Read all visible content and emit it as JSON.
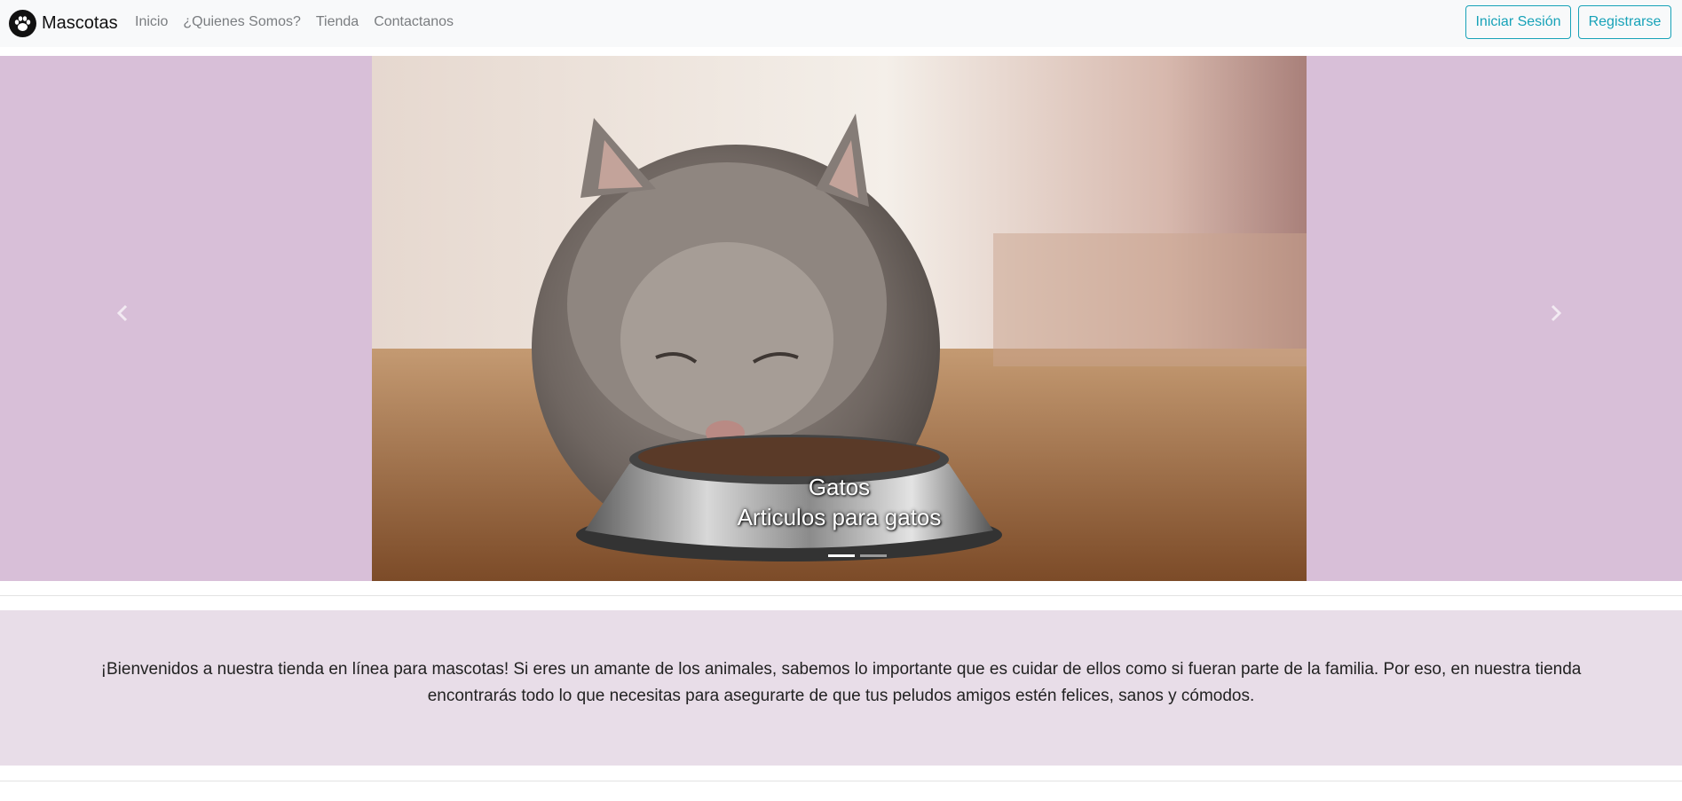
{
  "navbar": {
    "brand": "Mascotas",
    "links": [
      "Inicio",
      "¿Quienes Somos?",
      "Tienda",
      "Contactanos"
    ],
    "login_label": "Iniciar Sesión",
    "register_label": "Registrarse"
  },
  "carousel": {
    "caption_title": "Gatos",
    "caption_subtitle": "Articulos para gatos",
    "slide_count": 2,
    "active_index": 0,
    "bg_color": "#d8bfd8"
  },
  "welcome": {
    "text": "¡Bienvenidos a nuestra tienda en línea para mascotas! Si eres un amante de los animales, sabemos lo importante que es cuidar de ellos como si fueran parte de la familia. Por eso, en nuestra tienda encontrarás todo lo que necesitas para asegurarte de que tus peludos amigos estén felices, sanos y cómodos."
  },
  "colors": {
    "accent": "#17a2b8",
    "navbar_bg": "#f8f9fa",
    "welcome_bg": "#e8dde8"
  }
}
